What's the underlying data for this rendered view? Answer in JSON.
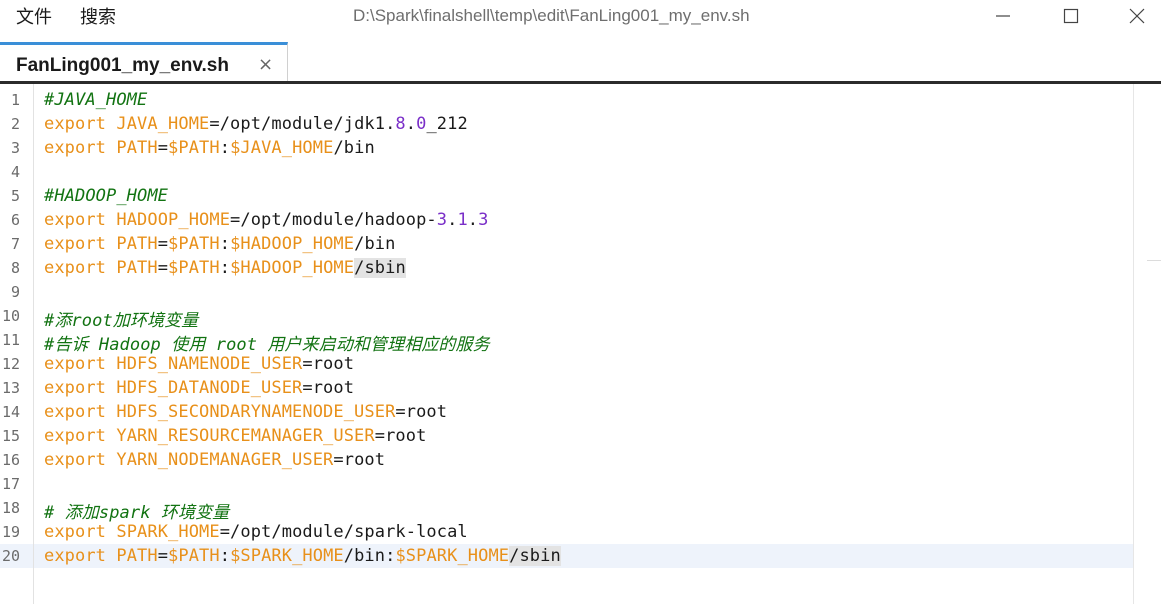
{
  "menu": {
    "file": "文件",
    "search": "搜索"
  },
  "window": {
    "title": "D:\\Spark\\finalshell\\temp\\edit\\FanLing001_my_env.sh"
  },
  "tabs": [
    {
      "label": "FanLing001_my_env.sh",
      "close": "×"
    }
  ],
  "editor": {
    "current_line": 20,
    "lines": [
      {
        "n": "1",
        "tokens": [
          {
            "t": "#JAVA_HOME",
            "c": "cmt"
          }
        ]
      },
      {
        "n": "2",
        "tokens": [
          {
            "t": "export ",
            "c": "kw"
          },
          {
            "t": "JAVA_HOME",
            "c": "var"
          },
          {
            "t": "=/opt/module/jdk1.",
            "c": "plain"
          },
          {
            "t": "8",
            "c": "num"
          },
          {
            "t": ".",
            "c": "plain"
          },
          {
            "t": "0",
            "c": "num"
          },
          {
            "t": "_212",
            "c": "plain"
          }
        ]
      },
      {
        "n": "3",
        "tokens": [
          {
            "t": "export ",
            "c": "kw"
          },
          {
            "t": "PATH",
            "c": "var"
          },
          {
            "t": "=",
            "c": "plain"
          },
          {
            "t": "$PATH",
            "c": "var"
          },
          {
            "t": ":",
            "c": "plain"
          },
          {
            "t": "$JAVA_HOME",
            "c": "var"
          },
          {
            "t": "/bin",
            "c": "plain"
          }
        ]
      },
      {
        "n": "4",
        "tokens": []
      },
      {
        "n": "5",
        "tokens": [
          {
            "t": "#HADOOP_HOME",
            "c": "cmt"
          }
        ]
      },
      {
        "n": "6",
        "tokens": [
          {
            "t": "export ",
            "c": "kw"
          },
          {
            "t": "HADOOP_HOME",
            "c": "var"
          },
          {
            "t": "=/opt/module/hadoop-",
            "c": "plain"
          },
          {
            "t": "3",
            "c": "num"
          },
          {
            "t": ".",
            "c": "plain"
          },
          {
            "t": "1",
            "c": "num"
          },
          {
            "t": ".",
            "c": "plain"
          },
          {
            "t": "3",
            "c": "num"
          }
        ]
      },
      {
        "n": "7",
        "tokens": [
          {
            "t": "export ",
            "c": "kw"
          },
          {
            "t": "PATH",
            "c": "var"
          },
          {
            "t": "=",
            "c": "plain"
          },
          {
            "t": "$PATH",
            "c": "var"
          },
          {
            "t": ":",
            "c": "plain"
          },
          {
            "t": "$HADOOP_HOME",
            "c": "var"
          },
          {
            "t": "/bin",
            "c": "plain"
          }
        ]
      },
      {
        "n": "8",
        "tokens": [
          {
            "t": "export ",
            "c": "kw"
          },
          {
            "t": "PATH",
            "c": "var"
          },
          {
            "t": "=",
            "c": "plain"
          },
          {
            "t": "$PATH",
            "c": "var"
          },
          {
            "t": ":",
            "c": "plain"
          },
          {
            "t": "$HADOOP_HOME",
            "c": "var"
          },
          {
            "t": "/sbin",
            "c": "plain hl"
          }
        ]
      },
      {
        "n": "9",
        "tokens": []
      },
      {
        "n": "10",
        "tokens": [
          {
            "t": "#添root加环境变量",
            "c": "cmt"
          }
        ]
      },
      {
        "n": "11",
        "tokens": [
          {
            "t": "#告诉 Hadoop 使用 root 用户来启动和管理相应的服务",
            "c": "cmt"
          }
        ]
      },
      {
        "n": "12",
        "tokens": [
          {
            "t": "export ",
            "c": "kw"
          },
          {
            "t": "HDFS_NAMENODE_USER",
            "c": "var"
          },
          {
            "t": "=root",
            "c": "plain"
          }
        ]
      },
      {
        "n": "13",
        "tokens": [
          {
            "t": "export ",
            "c": "kw"
          },
          {
            "t": "HDFS_DATANODE_USER",
            "c": "var"
          },
          {
            "t": "=root",
            "c": "plain"
          }
        ]
      },
      {
        "n": "14",
        "tokens": [
          {
            "t": "export ",
            "c": "kw"
          },
          {
            "t": "HDFS_SECONDARYNAMENODE_USER",
            "c": "var"
          },
          {
            "t": "=root",
            "c": "plain"
          }
        ]
      },
      {
        "n": "15",
        "tokens": [
          {
            "t": "export ",
            "c": "kw"
          },
          {
            "t": "YARN_RESOURCEMANAGER_USER",
            "c": "var"
          },
          {
            "t": "=root",
            "c": "plain"
          }
        ]
      },
      {
        "n": "16",
        "tokens": [
          {
            "t": "export ",
            "c": "kw"
          },
          {
            "t": "YARN_NODEMANAGER_USER",
            "c": "var"
          },
          {
            "t": "=root",
            "c": "plain"
          }
        ]
      },
      {
        "n": "17",
        "tokens": []
      },
      {
        "n": "18",
        "tokens": [
          {
            "t": "# 添加spark 环境变量",
            "c": "cmt"
          }
        ]
      },
      {
        "n": "19",
        "tokens": [
          {
            "t": "export ",
            "c": "kw"
          },
          {
            "t": "SPARK_HOME",
            "c": "var"
          },
          {
            "t": "=/opt/module/spark-local",
            "c": "plain"
          }
        ]
      },
      {
        "n": "20",
        "tokens": [
          {
            "t": "export ",
            "c": "kw"
          },
          {
            "t": "PATH",
            "c": "var"
          },
          {
            "t": "=",
            "c": "plain"
          },
          {
            "t": "$PATH",
            "c": "var"
          },
          {
            "t": ":",
            "c": "plain"
          },
          {
            "t": "$SPARK_HOME",
            "c": "var"
          },
          {
            "t": "/bin:",
            "c": "plain"
          },
          {
            "t": "$SPARK_HOME",
            "c": "var"
          },
          {
            "t": "/sbin",
            "c": "plain hl"
          }
        ]
      }
    ]
  }
}
